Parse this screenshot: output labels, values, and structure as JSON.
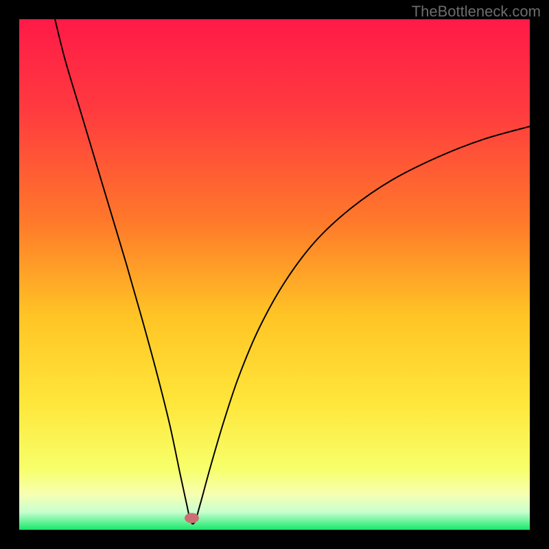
{
  "watermark": "TheBottleneck.com",
  "chart_data": {
    "type": "line",
    "title": "",
    "xlabel": "",
    "ylabel": "",
    "xlim": [
      0,
      100
    ],
    "ylim": [
      0,
      100
    ],
    "gradient_stops": [
      {
        "offset": 0.0,
        "color": "#ff1a47"
      },
      {
        "offset": 0.18,
        "color": "#ff3b3f"
      },
      {
        "offset": 0.4,
        "color": "#ff7a2a"
      },
      {
        "offset": 0.58,
        "color": "#ffc425"
      },
      {
        "offset": 0.75,
        "color": "#ffe63a"
      },
      {
        "offset": 0.88,
        "color": "#f7ff6a"
      },
      {
        "offset": 0.93,
        "color": "#f7ffb0"
      },
      {
        "offset": 0.965,
        "color": "#c9ffd0"
      },
      {
        "offset": 1.0,
        "color": "#17e86b"
      }
    ],
    "marker": {
      "x": 33.8,
      "y": 2.3,
      "rx": 1.4,
      "ry": 1.0,
      "color": "#cc6e72"
    },
    "series": [
      {
        "name": "bottleneck-curve",
        "stroke": "#000000",
        "stroke_width": 2.0,
        "points": [
          {
            "x": 7.0,
            "y": 100.0
          },
          {
            "x": 9.0,
            "y": 92.0
          },
          {
            "x": 12.0,
            "y": 82.0
          },
          {
            "x": 15.0,
            "y": 72.0
          },
          {
            "x": 18.0,
            "y": 62.0
          },
          {
            "x": 21.0,
            "y": 52.0
          },
          {
            "x": 24.0,
            "y": 41.5
          },
          {
            "x": 27.0,
            "y": 30.5
          },
          {
            "x": 29.5,
            "y": 20.5
          },
          {
            "x": 31.5,
            "y": 11.0
          },
          {
            "x": 32.8,
            "y": 5.0
          },
          {
            "x": 33.6,
            "y": 1.6
          },
          {
            "x": 34.4,
            "y": 1.6
          },
          {
            "x": 35.5,
            "y": 5.2
          },
          {
            "x": 37.5,
            "y": 12.5
          },
          {
            "x": 40.0,
            "y": 21.0
          },
          {
            "x": 43.0,
            "y": 30.0
          },
          {
            "x": 47.0,
            "y": 39.5
          },
          {
            "x": 52.0,
            "y": 48.5
          },
          {
            "x": 58.0,
            "y": 56.5
          },
          {
            "x": 65.0,
            "y": 63.0
          },
          {
            "x": 73.0,
            "y": 68.5
          },
          {
            "x": 82.0,
            "y": 73.0
          },
          {
            "x": 91.0,
            "y": 76.5
          },
          {
            "x": 100.0,
            "y": 79.0
          }
        ]
      }
    ]
  }
}
